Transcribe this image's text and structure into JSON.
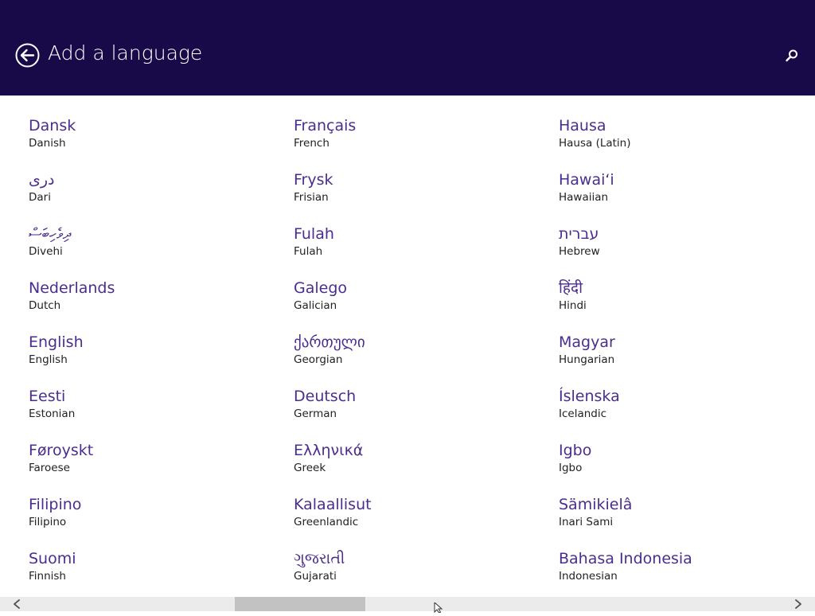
{
  "header": {
    "title": "Add a language",
    "back_icon": "back-arrow-circle-icon",
    "search_icon": "search-icon",
    "background": "#180a48"
  },
  "colors": {
    "native_text": "#4b2d8f",
    "english_text": "#222222",
    "scrollbar_track": "#ebebeb",
    "scrollbar_thumb": "#c2c2c2"
  },
  "columns": [
    {
      "items": [
        {
          "native": "Dansk",
          "english": "Danish"
        },
        {
          "native": "درى",
          "english": "Dari"
        },
        {
          "native": "ދިވެހިބަސް",
          "english": "Divehi"
        },
        {
          "native": "Nederlands",
          "english": "Dutch"
        },
        {
          "native": "English",
          "english": "English"
        },
        {
          "native": "Eesti",
          "english": "Estonian"
        },
        {
          "native": "Føroyskt",
          "english": "Faroese"
        },
        {
          "native": "Filipino",
          "english": "Filipino"
        },
        {
          "native": "Suomi",
          "english": "Finnish"
        }
      ]
    },
    {
      "items": [
        {
          "native": "Français",
          "english": "French"
        },
        {
          "native": "Frysk",
          "english": "Frisian"
        },
        {
          "native": "Fulah",
          "english": "Fulah"
        },
        {
          "native": "Galego",
          "english": "Galician"
        },
        {
          "native": "ქართული",
          "english": "Georgian"
        },
        {
          "native": "Deutsch",
          "english": "German"
        },
        {
          "native": "Ελληνικά",
          "english": "Greek"
        },
        {
          "native": "Kalaallisut",
          "english": "Greenlandic"
        },
        {
          "native": "ગુજરાતી",
          "english": "Gujarati"
        }
      ]
    },
    {
      "items": [
        {
          "native": "Hausa",
          "english": "Hausa (Latin)"
        },
        {
          "native": "Hawaiʻi",
          "english": "Hawaiian"
        },
        {
          "native": "עברית",
          "english": "Hebrew"
        },
        {
          "native": "हिंदी",
          "english": "Hindi"
        },
        {
          "native": "Magyar",
          "english": "Hungarian"
        },
        {
          "native": "Íslenska",
          "english": "Icelandic"
        },
        {
          "native": "Igbo",
          "english": "Igbo"
        },
        {
          "native": "Sämikielâ",
          "english": "Inari Sami"
        },
        {
          "native": "Bahasa Indonesia",
          "english": "Indonesian"
        }
      ]
    }
  ],
  "scrollbar": {
    "left_icon": "chevron-left-icon",
    "right_icon": "chevron-right-icon",
    "position_fraction": 0.29
  }
}
